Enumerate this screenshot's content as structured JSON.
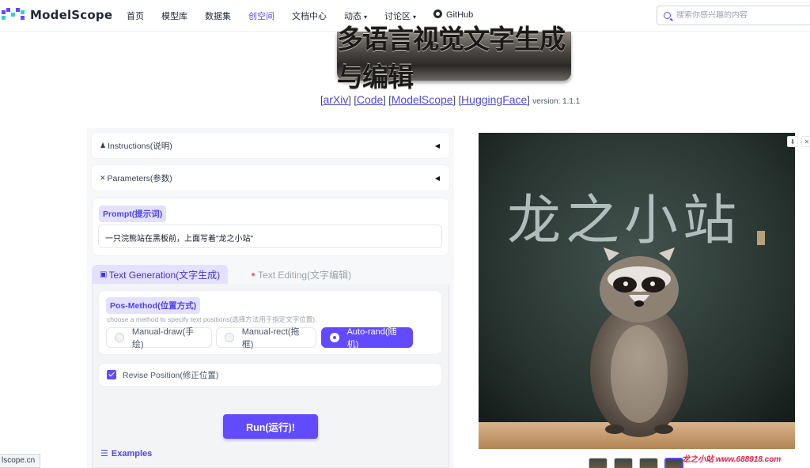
{
  "nav": {
    "logo_text": "ModelScope",
    "items": [
      {
        "label": "首页",
        "active": false
      },
      {
        "label": "模型库",
        "active": false
      },
      {
        "label": "数据集",
        "active": false
      },
      {
        "label": "创空间",
        "active": true
      },
      {
        "label": "文档中心",
        "active": false
      },
      {
        "label": "动态",
        "caret": "▾",
        "active": false
      },
      {
        "label": "讨论区",
        "caret": "▾",
        "active": false
      },
      {
        "label": "GitHub",
        "icon": "github-icon",
        "active": false
      }
    ],
    "search_placeholder": "搜索你感兴趣的内容"
  },
  "banner": {
    "title": "多语言视觉文字生成与编辑"
  },
  "links": {
    "arxiv": "arXiv",
    "code": "Code",
    "modelscope": "ModelScope",
    "huggingface": "HuggingFace",
    "version": "version: 1.1.1"
  },
  "panel": {
    "instructions_label": "Instructions(说明)",
    "parameters_label": "Parameters(参数)",
    "prompt_label": "Prompt(提示词)",
    "prompt_value": "一只浣熊站在黑板前，上面写着\"龙之小站\"",
    "tab_generation": "Text Generation(文字生成)",
    "tab_editing": "Text Editing(文字编辑)",
    "pos_method_label": "Pos-Method(位置方式)",
    "pos_method_hint": "choose a method to specify text positions(选择方法用于指定文字位置).",
    "options": [
      {
        "label": "Manual-draw(手绘)",
        "selected": false
      },
      {
        "label": "Manual-rect(拖框)",
        "selected": false
      },
      {
        "label": "Auto-rand(随机)",
        "selected": true
      }
    ],
    "revise_position_label": "Revise Position(修正位置)",
    "revise_position_checked": true,
    "run_button": "Run(运行)!",
    "examples_label": "Examples"
  },
  "output": {
    "blackboard_text": "龙之小站",
    "thumbnail_count": 4,
    "selected_thumbnail": 4
  },
  "status_url": "lscope.cn",
  "watermark": "龙之小站 www.688918.com",
  "colors": {
    "accent": "#624aff",
    "accent_light": "#e3e1ff"
  }
}
